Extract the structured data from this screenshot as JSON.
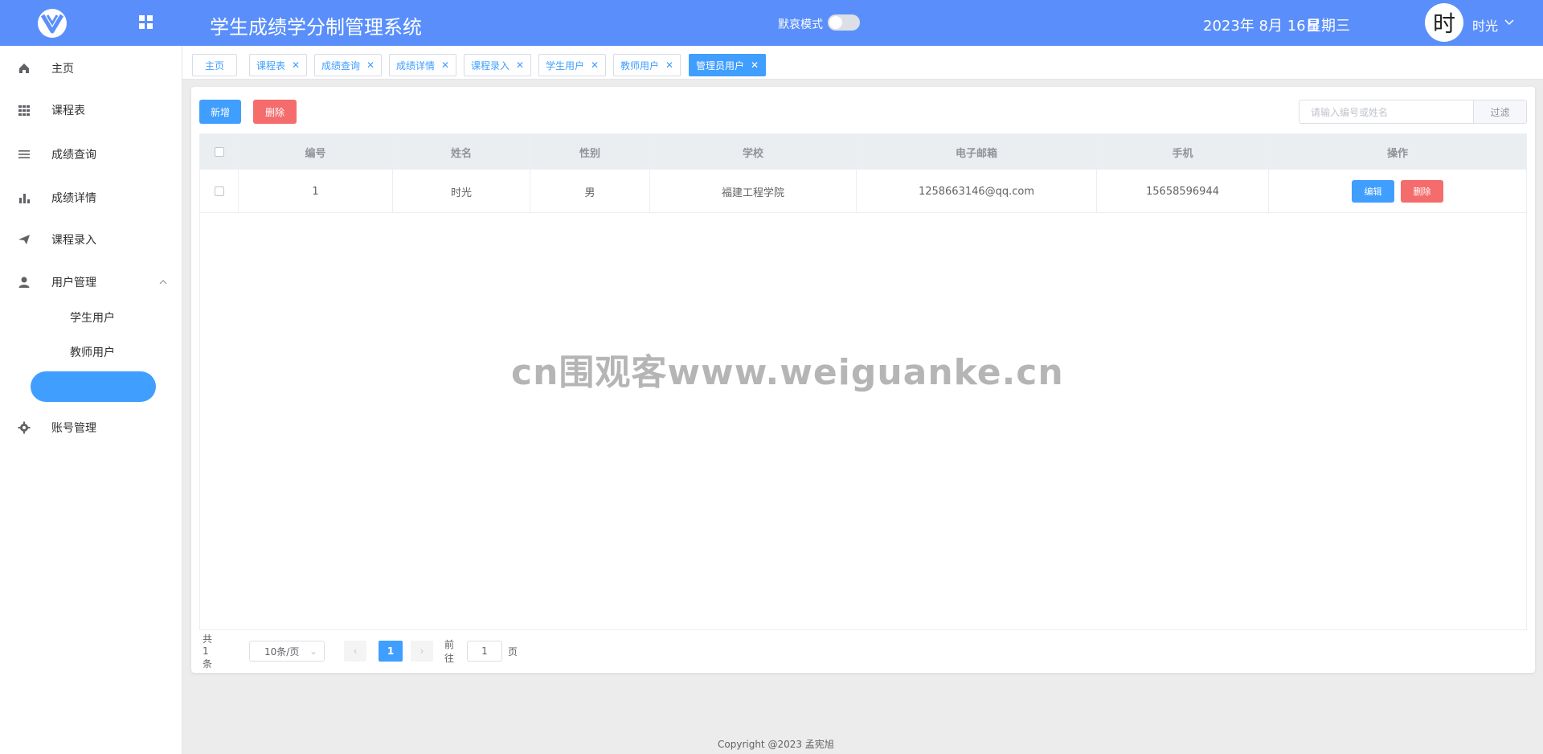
{
  "header": {
    "app_title": "学生成绩学分制管理系统",
    "mode_label": "默哀模式",
    "date": "2023年 8月 16日",
    "weekday": "星期三",
    "avatar_char": "时",
    "user_name": "时光",
    "brand_color": "#5a8ffb"
  },
  "sidebar": {
    "items": [
      {
        "label": "主页",
        "icon": "home-icon"
      },
      {
        "label": "课程表",
        "icon": "grid-icon"
      },
      {
        "label": "成绩查询",
        "icon": "list-icon"
      },
      {
        "label": "成绩详情",
        "icon": "bar-chart-icon"
      },
      {
        "label": "课程录入",
        "icon": "send-icon"
      },
      {
        "label": "用户管理",
        "icon": "user-icon"
      },
      {
        "label": "账号管理",
        "icon": "gear-icon"
      }
    ],
    "sub_items": [
      {
        "label": "学生用户"
      },
      {
        "label": "教师用户"
      }
    ]
  },
  "tabs": [
    {
      "label": "主页",
      "closable": false
    },
    {
      "label": "课程表",
      "closable": true
    },
    {
      "label": "成绩查询",
      "closable": true
    },
    {
      "label": "成绩详情",
      "closable": true
    },
    {
      "label": "课程录入",
      "closable": true
    },
    {
      "label": "学生用户",
      "closable": true
    },
    {
      "label": "教师用户",
      "closable": true
    },
    {
      "label": "管理员用户",
      "closable": true,
      "active": true
    }
  ],
  "toolbar": {
    "add_label": "新增",
    "delete_label": "删除",
    "search_placeholder": "请输入编号或姓名",
    "filter_label": "过滤"
  },
  "table": {
    "columns": [
      "编号",
      "姓名",
      "性别",
      "学校",
      "电子邮箱",
      "手机",
      "操作"
    ],
    "rows": [
      {
        "id": "1",
        "name": "时光",
        "gender": "男",
        "school": "福建工程学院",
        "email": "1258663146@qq.com",
        "phone": "15658596944",
        "edit_label": "编辑",
        "delete_label": "删除"
      }
    ]
  },
  "pagination": {
    "total_text": "共 1 条",
    "page_size": "10条/页",
    "current_page": "1",
    "goto_prefix": "前往",
    "goto_value": "1",
    "goto_suffix": "页"
  },
  "watermark": "cn围观客www.weiguanke.cn",
  "footer": "Copyright @2023 孟宪旭"
}
